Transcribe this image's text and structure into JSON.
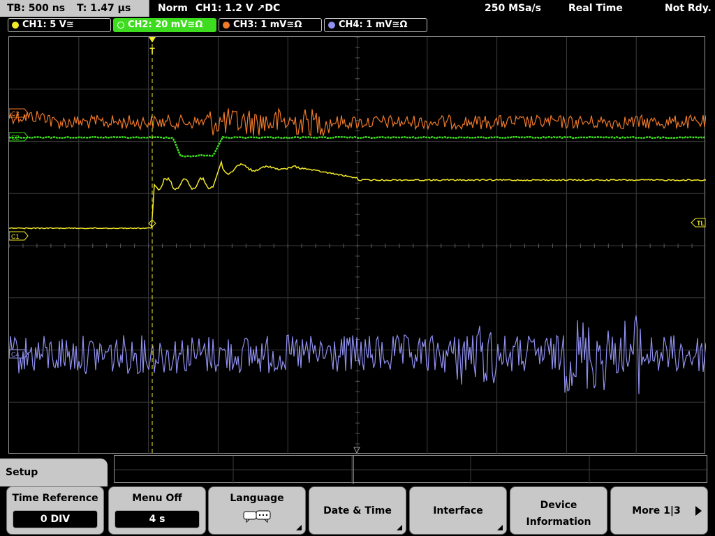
{
  "status": {
    "timebase": "TB: 500 ns",
    "trigger_time": "T: 1.47 µs",
    "mode": "Norm",
    "trigger_source": "CH1: 1.2 V ↗DC",
    "sample_rate": "250 MSa/s",
    "acquisition": "Real Time",
    "state": "Not Rdy."
  },
  "channels": [
    {
      "label": "CH1: 5 V≅",
      "color": "#f2ea28",
      "active": false
    },
    {
      "label": "CH2: 20 mV≅Ω",
      "color": "#3ddc1e",
      "active": true
    },
    {
      "label": "CH3: 1 mV≅Ω",
      "color": "#f07a2a",
      "active": false
    },
    {
      "label": "CH4: 1 mV≅Ω",
      "color": "#9090f0",
      "active": false
    }
  ],
  "markers": {
    "ch1": "C1",
    "ch2": "C2",
    "ch3": "C3",
    "ch4": "C4",
    "trigger_level": "TL",
    "trigger_position": "T"
  },
  "menu": {
    "title": "Setup",
    "softkeys": [
      {
        "label": "Time Reference",
        "value": "0 DIV"
      },
      {
        "label": "Menu Off",
        "value": "4 s"
      },
      {
        "label": "Language",
        "icon": "speech-bubble-icon"
      },
      {
        "label": "Date & Time"
      },
      {
        "label": "Interface"
      },
      {
        "label_line1": "Device",
        "label_line2": "Information"
      },
      {
        "label": "More 1|3"
      }
    ]
  }
}
